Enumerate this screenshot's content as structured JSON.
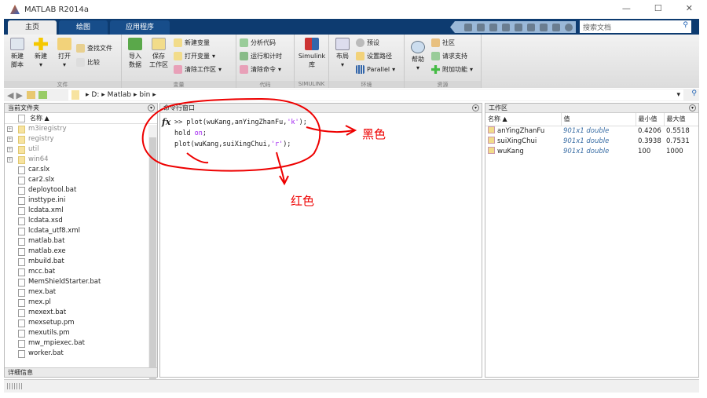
{
  "window": {
    "title": "MATLAB R2014a",
    "min": "—",
    "max": "☐",
    "close": "✕"
  },
  "tabs": [
    {
      "label": "主页",
      "active": true
    },
    {
      "label": "绘图"
    },
    {
      "label": "应用程序"
    }
  ],
  "search": {
    "placeholder": "搜索文档"
  },
  "ribbon": {
    "file": {
      "label": "文件",
      "new_script": "新建\n脚本",
      "new": "新建",
      "open": "打开",
      "find_files": "查找文件",
      "compare": "比较"
    },
    "variable": {
      "label": "变量",
      "import": "导入\n数据",
      "save_ws": "保存\n工作区",
      "new_var": "新建变量",
      "open_var": "打开变量",
      "clear_ws": "清除工作区"
    },
    "code": {
      "label": "代码",
      "analyze": "分析代码",
      "run_time": "运行和计时",
      "clear_cmd": "清除命令"
    },
    "simulink": {
      "label": "SIMULINK",
      "lib": "Simulink\n库"
    },
    "env": {
      "label": "环境",
      "layout": "布局",
      "prefs": "预设",
      "set_path": "设置路径",
      "parallel": "Parallel"
    },
    "resources": {
      "label": "资源",
      "help": "帮助",
      "community": "社区",
      "support": "请求支持",
      "addons": "附加功能"
    }
  },
  "address": {
    "crumbs": [
      "D:",
      "Matlab",
      "bin"
    ]
  },
  "files": {
    "title": "当前文件夹",
    "col_name": "名称 ▲",
    "details": "详细信息",
    "items": [
      {
        "name": "m3iregistry",
        "type": "folder"
      },
      {
        "name": "registry",
        "type": "folder"
      },
      {
        "name": "util",
        "type": "folder"
      },
      {
        "name": "win64",
        "type": "folder"
      },
      {
        "name": "car.slx"
      },
      {
        "name": "car2.slx"
      },
      {
        "name": "deploytool.bat"
      },
      {
        "name": "insttype.ini"
      },
      {
        "name": "lcdata.xml"
      },
      {
        "name": "lcdata.xsd"
      },
      {
        "name": "lcdata_utf8.xml"
      },
      {
        "name": "matlab.bat"
      },
      {
        "name": "matlab.exe"
      },
      {
        "name": "mbuild.bat"
      },
      {
        "name": "mcc.bat"
      },
      {
        "name": "MemShieldStarter.bat"
      },
      {
        "name": "mex.bat"
      },
      {
        "name": "mex.pl"
      },
      {
        "name": "mexext.bat"
      },
      {
        "name": "mexsetup.pm"
      },
      {
        "name": "mexutils.pm"
      },
      {
        "name": "mw_mpiexec.bat"
      },
      {
        "name": "worker.bat"
      }
    ]
  },
  "command": {
    "title": "命令行窗口",
    "prompt": ">>",
    "lines": [
      {
        "pre": "plot(wuKang,anYingZhanFu,",
        "str": "'k'",
        "post": ");"
      },
      {
        "pre": "hold ",
        "str": "on",
        "post": ";"
      },
      {
        "pre": "plot(wuKang,suiXingChui,",
        "str": "'r'",
        "post": ");"
      }
    ]
  },
  "workspace": {
    "title": "工作区",
    "cols": [
      "名称 ▲",
      "值",
      "最小值",
      "最大值"
    ],
    "rows": [
      {
        "name": "anYingZhanFu",
        "value": "901x1 double",
        "min": "0.4206",
        "max": "0.5518"
      },
      {
        "name": "suiXingChui",
        "value": "901x1 double",
        "min": "0.3938",
        "max": "0.7531"
      },
      {
        "name": "wuKang",
        "value": "901x1 double",
        "min": "100",
        "max": "1000"
      }
    ]
  },
  "annotations": {
    "black": "黑色",
    "red": "红色",
    "color": "#e00000"
  }
}
